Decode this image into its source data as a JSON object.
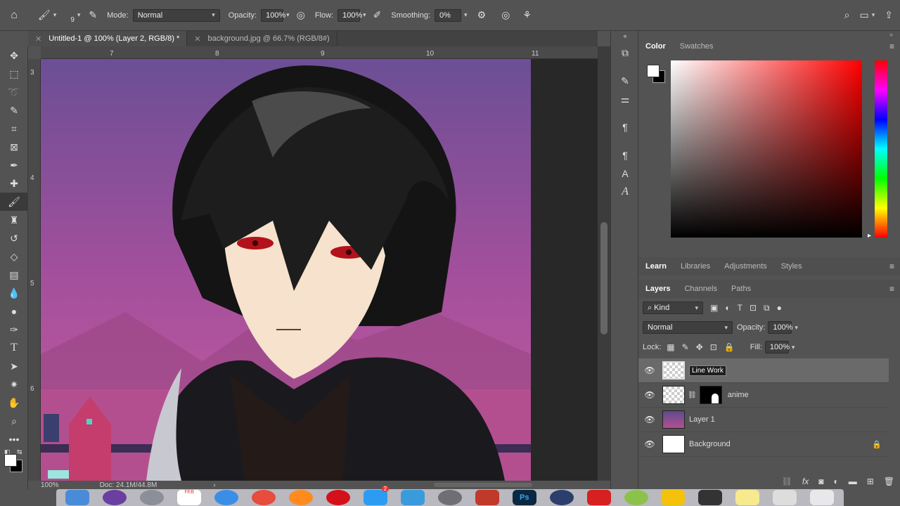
{
  "options_bar": {
    "brush_size": "9",
    "mode_label": "Mode:",
    "mode_value": "Normal",
    "opacity_label": "Opacity:",
    "opacity_value": "100%",
    "flow_label": "Flow:",
    "flow_value": "100%",
    "smoothing_label": "Smoothing:",
    "smoothing_value": "0%"
  },
  "tabs": [
    {
      "label": "Untitled-1 @ 100% (Layer 2, RGB/8) *",
      "active": true
    },
    {
      "label": "background.jpg @ 66.7% (RGB/8#)",
      "active": false
    }
  ],
  "ruler": {
    "h_labels": [
      "7",
      "8",
      "9",
      "10",
      "11"
    ],
    "v_labels": [
      "3",
      "4",
      "5",
      "6"
    ]
  },
  "status": {
    "zoom": "100%",
    "doc": "Doc: 24.1M/44.8M"
  },
  "color_panel": {
    "tabs": [
      "Color",
      "Swatches"
    ],
    "fg_color": "#ffffff",
    "bg_color": "#000000",
    "hue_color": "#ff0000"
  },
  "learn_panel": {
    "tabs": [
      "Learn",
      "Libraries",
      "Adjustments",
      "Styles"
    ]
  },
  "layers_panel": {
    "tabs": [
      "Layers",
      "Channels",
      "Paths"
    ],
    "filter_label": "Kind",
    "blend_mode": "Normal",
    "opacity_label": "Opacity:",
    "opacity_value": "100%",
    "lock_label": "Lock:",
    "fill_label": "Fill:",
    "fill_value": "100%",
    "layers": [
      {
        "name": "Line Work",
        "selected": true
      },
      {
        "name": "anime",
        "selected": false
      },
      {
        "name": "Layer 1",
        "selected": false
      },
      {
        "name": "Background",
        "selected": false
      }
    ]
  },
  "dock": {
    "badge": "2",
    "calendar_month": "FEB"
  }
}
